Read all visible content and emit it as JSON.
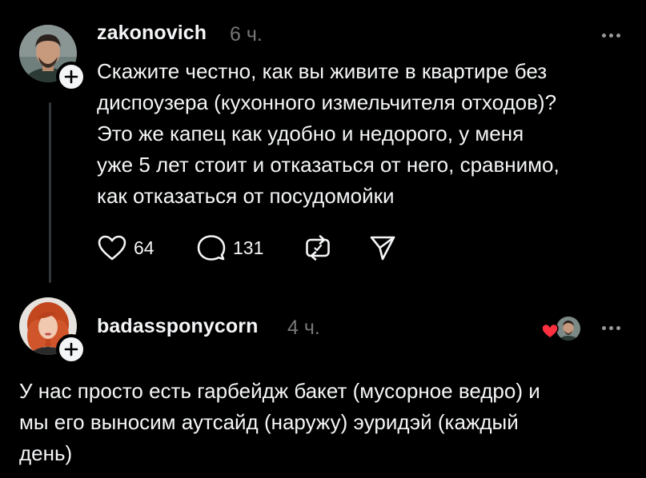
{
  "post1": {
    "username": "zakonovich",
    "time": "6 ч.",
    "text_lines": [
      "Скажите честно, как вы живите в квартире без",
      "диспоузера (кухонного измельчителя отходов)?",
      "Это же капец как удобно и недорого, у меня",
      "уже 5 лет стоит и отказаться от него, сравнимо,",
      "как отказаться от посудомойки"
    ],
    "likes": "64",
    "replies": "131"
  },
  "post2": {
    "username": "badassponycorn",
    "time": "4 ч.",
    "text_lines": [
      "У нас просто есть гарбейдж бакет (мусорное ведро) и",
      "мы его выносим аутсайд (наружу) эуридэй (каждый",
      "день)"
    ]
  },
  "icons": {
    "like": "heart-icon",
    "reply": "comment-icon",
    "repost": "repost-icon",
    "share": "send-icon",
    "more": "more-dots-icon",
    "follow": "plus-icon",
    "liked_by_author": "red-heart-icon"
  },
  "colors": {
    "background": "#000000",
    "text": "#f3f5f7",
    "muted": "#777777",
    "thread_line": "#333638",
    "liked_heart": "#ff3040"
  }
}
